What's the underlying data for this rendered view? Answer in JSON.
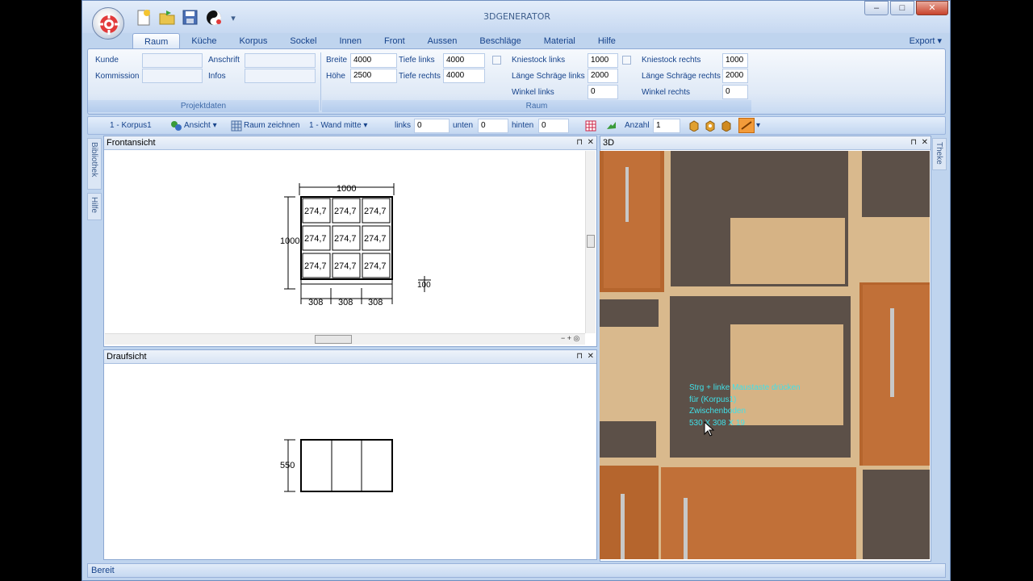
{
  "app": {
    "title": "3DGENERATOR",
    "export_label": "Export"
  },
  "window_buttons": {
    "minimize": "–",
    "maximize": "□",
    "close": "✕"
  },
  "tabs": [
    "Raum",
    "Küche",
    "Korpus",
    "Sockel",
    "Innen",
    "Front",
    "Aussen",
    "Beschläge",
    "Material",
    "Hilfe"
  ],
  "active_tab": "Raum",
  "projektdaten": {
    "group_label": "Projektdaten",
    "kunde_label": "Kunde",
    "kunde_value": "",
    "kommission_label": "Kommission",
    "kommission_value": "",
    "anschrift_label": "Anschrift",
    "anschrift_value": "",
    "infos_label": "Infos",
    "infos_value": ""
  },
  "raum": {
    "group_label": "Raum",
    "breite_label": "Breite",
    "breite_value": "4000",
    "hoehe_label": "Höhe",
    "hoehe_value": "2500",
    "tiefe_links_label": "Tiefe links",
    "tiefe_links_value": "4000",
    "tiefe_rechts_label": "Tiefe rechts",
    "tiefe_rechts_value": "4000",
    "kniestock_links_label": "Kniestock links",
    "kniestock_links_value": "1000",
    "laenge_schraege_links_label": "Länge Schräge links",
    "laenge_schraege_links_value": "2000",
    "winkel_links_label": "Winkel links",
    "winkel_links_value": "0",
    "kniestock_rechts_label": "Kniestock rechts",
    "kniestock_rechts_value": "1000",
    "laenge_schraege_rechts_label": "Länge Schräge rechts",
    "laenge_schraege_rechts_value": "2000",
    "winkel_rechts_label": "Winkel rechts",
    "winkel_rechts_value": "0"
  },
  "toolbar": {
    "korpus_select": "1 - Korpus1",
    "ansicht_label": "Ansicht",
    "raum_zeichnen_label": "Raum zeichnen",
    "wand_select": "1 - Wand mitte",
    "links_label": "links",
    "links_value": "0",
    "unten_label": "unten",
    "unten_value": "0",
    "hinten_label": "hinten",
    "hinten_value": "0",
    "anzahl_label": "Anzahl",
    "anzahl_value": "1"
  },
  "side_tabs": {
    "left": [
      "Bibliothek",
      "Hilfe"
    ],
    "right": [
      "Theke"
    ]
  },
  "panels": {
    "front": "Frontansicht",
    "top": "Draufsicht",
    "view3d": "3D"
  },
  "front_drawing": {
    "width_dim": "1000",
    "height_dim": "1000",
    "side_dim": "100",
    "cells": [
      "274,7",
      "274,7",
      "274,7",
      "274,7",
      "274,7",
      "274,7",
      "274,7",
      "274,7",
      "274,7"
    ],
    "bottom_dims": [
      "308",
      "308",
      "308"
    ]
  },
  "top_drawing": {
    "depth_dim": "550"
  },
  "tooltip": {
    "lines": [
      "Strg + linke Maustaste drücken",
      "für (Korpus1)",
      "Zwischenboden",
      "530 X 308 X 19"
    ]
  },
  "status": {
    "text": "Bereit"
  }
}
